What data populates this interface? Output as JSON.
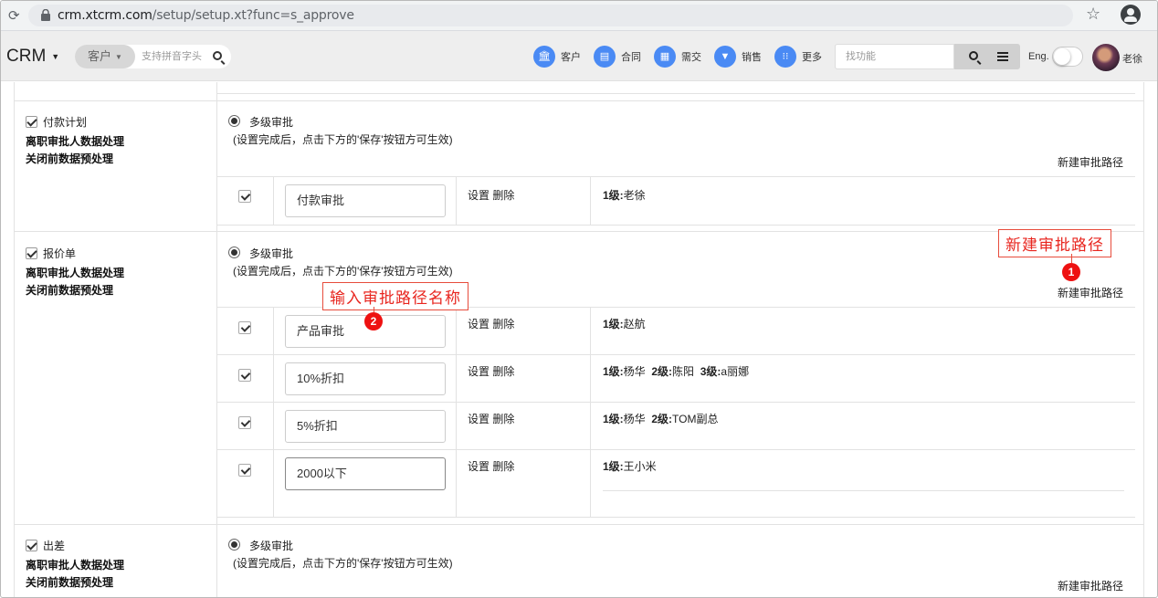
{
  "browser": {
    "url_host": "crm.xtcrm.com",
    "url_path": "/setup/setup.xt?func=s_approve"
  },
  "header": {
    "logo": "CRM",
    "search_type": "客户",
    "search_placeholder": "支持拼音字头",
    "nav": [
      {
        "label": "客户",
        "glyph": "🏛",
        "icon": "bank-icon"
      },
      {
        "label": "合同",
        "glyph": "▤",
        "icon": "document-icon"
      },
      {
        "label": "需交",
        "glyph": "▦",
        "icon": "grid-icon"
      },
      {
        "label": "销售",
        "glyph": "▼",
        "icon": "funnel-icon"
      },
      {
        "label": "更多",
        "glyph": "⁝⁝",
        "icon": "more-icon"
      }
    ],
    "func_placeholder": "找功能",
    "lang_label": "Eng.",
    "user_name": "老徐"
  },
  "sections": [
    {
      "name": "付款计划",
      "opt1": "离职审批人数据处理",
      "opt2": "关闭前数据预处理",
      "mode": "多级审批",
      "hint": "(设置完成后，点击下方的'保存'按钮方可生效)",
      "new_path": "新建审批路径",
      "rows": [
        {
          "name": "付款审批",
          "ops": "设置 删除",
          "levels": [
            {
              "k": "1级:",
              "v": "老徐"
            }
          ]
        }
      ]
    },
    {
      "name": "报价单",
      "opt1": "离职审批人数据处理",
      "opt2": "关闭前数据预处理",
      "mode": "多级审批",
      "hint": "(设置完成后，点击下方的'保存'按钮方可生效)",
      "new_path": "新建审批路径",
      "rows": [
        {
          "name": "产品审批",
          "ops": "设置 删除",
          "levels": [
            {
              "k": "1级:",
              "v": "赵航"
            }
          ]
        },
        {
          "name": "10%折扣",
          "ops": "设置 删除",
          "levels": [
            {
              "k": "1级:",
              "v": "杨华"
            },
            {
              "k": "2级:",
              "v": "陈阳"
            },
            {
              "k": "3级:",
              "v": "a丽娜"
            }
          ]
        },
        {
          "name": "5%折扣",
          "ops": "设置 删除",
          "levels": [
            {
              "k": "1级:",
              "v": "杨华"
            },
            {
              "k": "2级:",
              "v": "TOM副总"
            }
          ]
        },
        {
          "name": "2000以下",
          "ops": "设置 删除",
          "levels": [
            {
              "k": "1级:",
              "v": "王小米"
            }
          ]
        }
      ]
    },
    {
      "name": "出差",
      "opt1": "离职审批人数据处理",
      "opt2": "关闭前数据预处理",
      "mode": "多级审批",
      "hint": "(设置完成后，点击下方的'保存'按钮方可生效)",
      "new_path": "新建审批路径"
    }
  ],
  "annotations": {
    "a1_text": "新建审批路径",
    "a1_num": "1",
    "a2_text": "输入审批路径名称",
    "a2_num": "2"
  },
  "colors": {
    "accent_blue": "#4a8af4",
    "annotation_red": "#e8261f"
  }
}
